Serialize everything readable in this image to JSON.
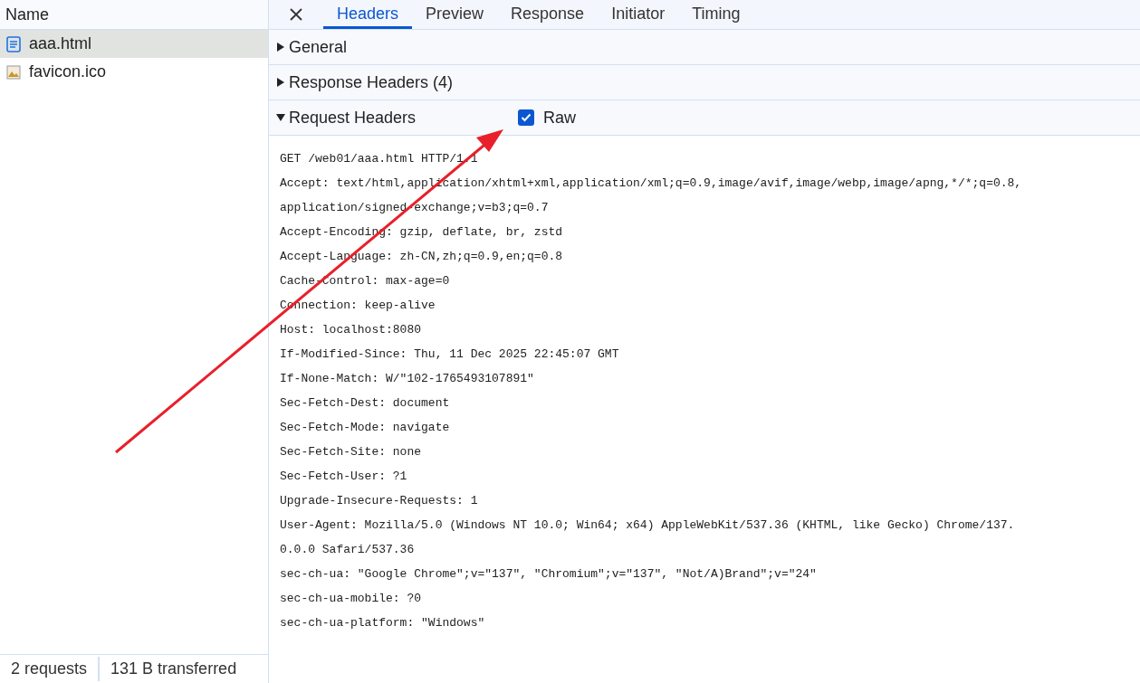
{
  "requests": {
    "column": "Name",
    "rows": [
      {
        "name": "aaa.html",
        "kind": "document",
        "selected": true
      },
      {
        "name": "favicon.ico",
        "kind": "image",
        "selected": false
      }
    ]
  },
  "status_bar": [
    "2 requests",
    "131 B transferred"
  ],
  "tabs": [
    {
      "label": "Headers",
      "selected": true
    },
    {
      "label": "Preview",
      "selected": false
    },
    {
      "label": "Response",
      "selected": false
    },
    {
      "label": "Initiator",
      "selected": false
    },
    {
      "label": "Timing",
      "selected": false
    }
  ],
  "sections": [
    {
      "title": "General",
      "expanded": false
    },
    {
      "title": "Response Headers (4)",
      "expanded": false
    },
    {
      "title": "Request Headers",
      "expanded": true,
      "raw": {
        "label": "Raw",
        "checked": true
      }
    }
  ],
  "raw_lines": [
    "GET /web01/aaa.html HTTP/1.1",
    "Accept: text/html,application/xhtml+xml,application/xml;q=0.9,image/avif,image/webp,image/apng,*/*;q=0.8,",
    "application/signed-exchange;v=b3;q=0.7",
    "Accept-Encoding: gzip, deflate, br, zstd",
    "Accept-Language: zh-CN,zh;q=0.9,en;q=0.8",
    "Cache-Control: max-age=0",
    "Connection: keep-alive",
    "Host: localhost:8080",
    "If-Modified-Since: Thu, 11 Dec 2025 22:45:07 GMT",
    "If-None-Match: W/\"102-1765493107891\"",
    "Sec-Fetch-Dest: document",
    "Sec-Fetch-Mode: navigate",
    "Sec-Fetch-Site: none",
    "Sec-Fetch-User: ?1",
    "Upgrade-Insecure-Requests: 1",
    "User-Agent: Mozilla/5.0 (Windows NT 10.0; Win64; x64) AppleWebKit/537.36 (KHTML, like Gecko) Chrome/137.",
    "0.0.0 Safari/537.36",
    "sec-ch-ua: \"Google Chrome\";v=\"137\", \"Chromium\";v=\"137\", \"Not/A)Brand\";v=\"24\"",
    "sec-ch-ua-mobile: ?0",
    "sec-ch-ua-platform: \"Windows\""
  ],
  "annotation": {
    "kind": "arrow",
    "color": "#e8202a"
  }
}
